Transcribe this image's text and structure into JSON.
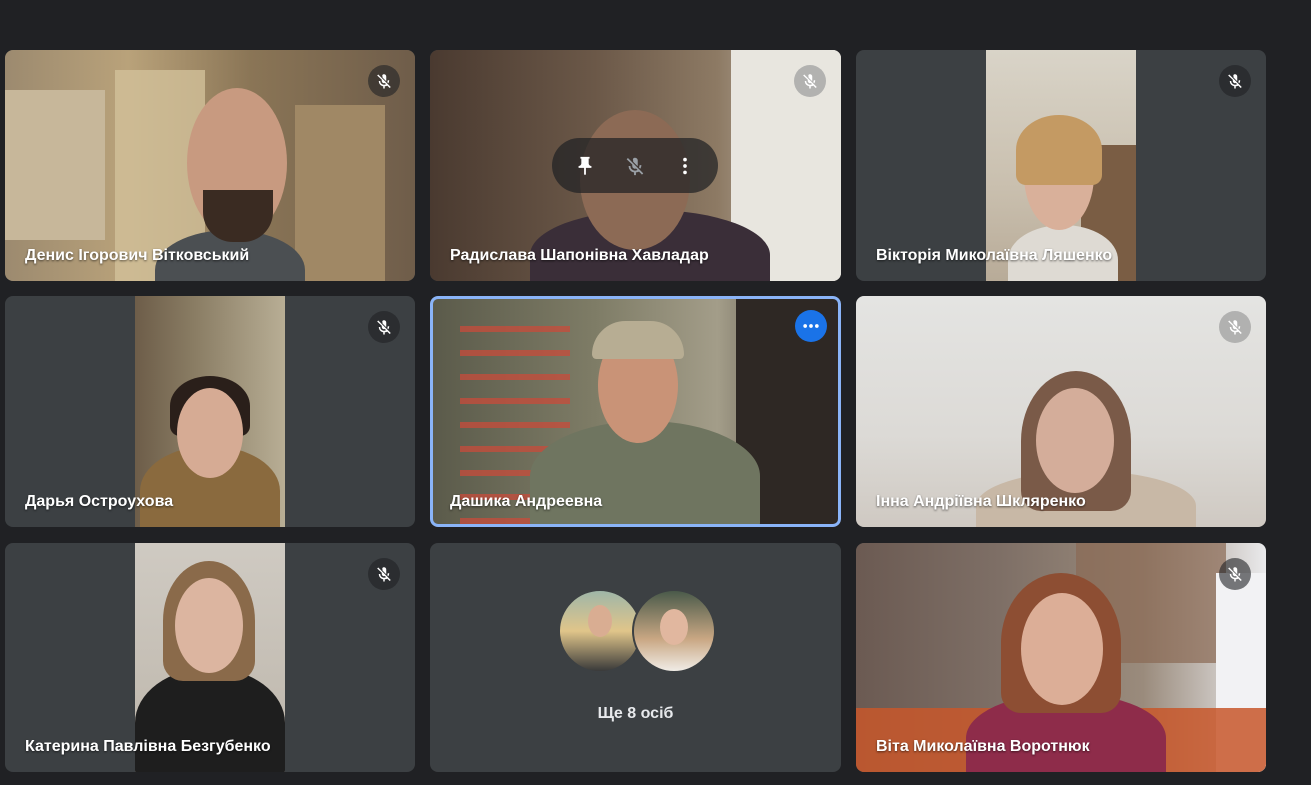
{
  "participants": [
    {
      "name": "Денис Ігорович Вітковський",
      "muted": true
    },
    {
      "name": "Радислава Шапонівна Хавладар",
      "muted": true
    },
    {
      "name": "Вікторія Миколаївна Ляшенко",
      "muted": true
    },
    {
      "name": "Дарья Остроухова",
      "muted": true
    },
    {
      "name": "Дашика Андреевна",
      "muted": false,
      "active_speaker": true
    },
    {
      "name": "Інна Андріївна Шкляренко",
      "muted": true
    },
    {
      "name": "Катерина Павлівна Безгубенко",
      "muted": true
    },
    {
      "name": "Віта Миколаївна Воротнюк",
      "muted": true
    }
  ],
  "overflow_tile": {
    "label": "Ще 8 осіб"
  },
  "hover_controls": [
    "pin-icon",
    "mic-off-icon",
    "more-vert-icon"
  ],
  "icons": {
    "muted": "mic-off-icon",
    "options": "more-horiz-icon"
  },
  "colors": {
    "background": "#202124",
    "tile": "#3c4043",
    "accent": "#1a73e8",
    "active_border": "#8ab4f8"
  }
}
